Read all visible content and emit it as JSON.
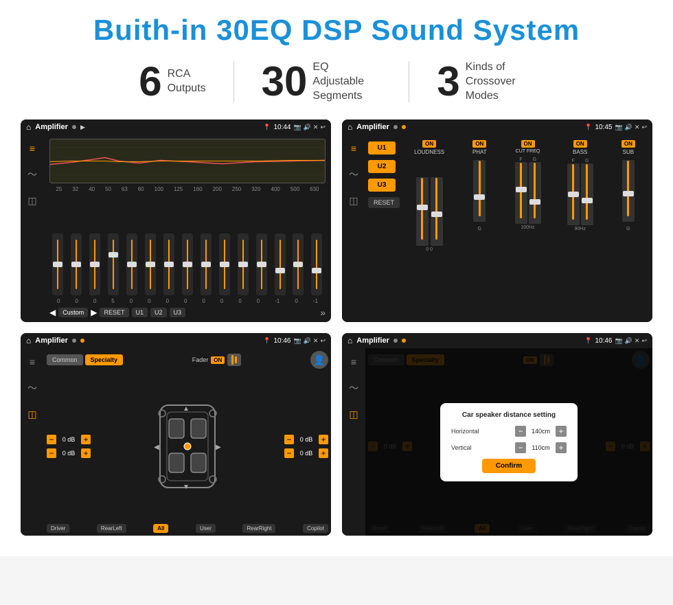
{
  "page": {
    "title": "Buith-in 30EQ DSP Sound System",
    "stats": [
      {
        "number": "6",
        "label": "RCA\nOutputs"
      },
      {
        "number": "30",
        "label": "EQ Adjustable\nSegments"
      },
      {
        "number": "3",
        "label": "Kinds of\nCrossover Modes"
      }
    ]
  },
  "screen1": {
    "title": "Amplifier",
    "time": "10:44",
    "app_label": "Amplifier",
    "eq_freqs": [
      "25",
      "32",
      "40",
      "50",
      "63",
      "80",
      "100",
      "125",
      "160",
      "200",
      "250",
      "320",
      "400",
      "500",
      "630"
    ],
    "eq_values": [
      "0",
      "0",
      "0",
      "5",
      "0",
      "0",
      "0",
      "0",
      "0",
      "0",
      "0",
      "0",
      "-1",
      "0",
      "-1"
    ],
    "preset_label": "Custom",
    "btns": [
      "RESET",
      "U1",
      "U2",
      "U3"
    ]
  },
  "screen2": {
    "title": "Amplifier",
    "time": "10:45",
    "app_label": "Amplifier",
    "presets": [
      "U1",
      "U2",
      "U3"
    ],
    "channels": [
      "LOUDNESS",
      "PHAT",
      "CUT FREQ",
      "BASS",
      "SUB"
    ],
    "on_labels": [
      "ON",
      "ON",
      "ON",
      "ON",
      "ON"
    ],
    "reset_label": "RESET"
  },
  "screen3": {
    "title": "Amplifier",
    "time": "10:46",
    "app_label": "Amplifier",
    "tabs": [
      "Common",
      "Specialty"
    ],
    "fader_label": "Fader",
    "fader_on": "ON",
    "vol_rows": [
      {
        "val": "0 dB"
      },
      {
        "val": "0 dB"
      },
      {
        "val": "0 dB"
      },
      {
        "val": "0 dB"
      }
    ],
    "bottom_btns": [
      "Driver",
      "RearLeft",
      "All",
      "User",
      "RearRight",
      "Copilot"
    ]
  },
  "screen4": {
    "title": "Amplifier",
    "time": "10:46",
    "app_label": "Amplifier",
    "tabs": [
      "Common",
      "Specialty"
    ],
    "dialog": {
      "title": "Car speaker distance setting",
      "horizontal_label": "Horizontal",
      "horizontal_val": "140cm",
      "vertical_label": "Vertical",
      "vertical_val": "110cm",
      "confirm_label": "Confirm"
    },
    "vol_rows": [
      {
        "val": "0 dB"
      },
      {
        "val": "0 dB"
      }
    ],
    "bottom_btns": [
      "Driver",
      "RearLeft",
      "All",
      "User",
      "RearRight",
      "Copilot"
    ]
  }
}
